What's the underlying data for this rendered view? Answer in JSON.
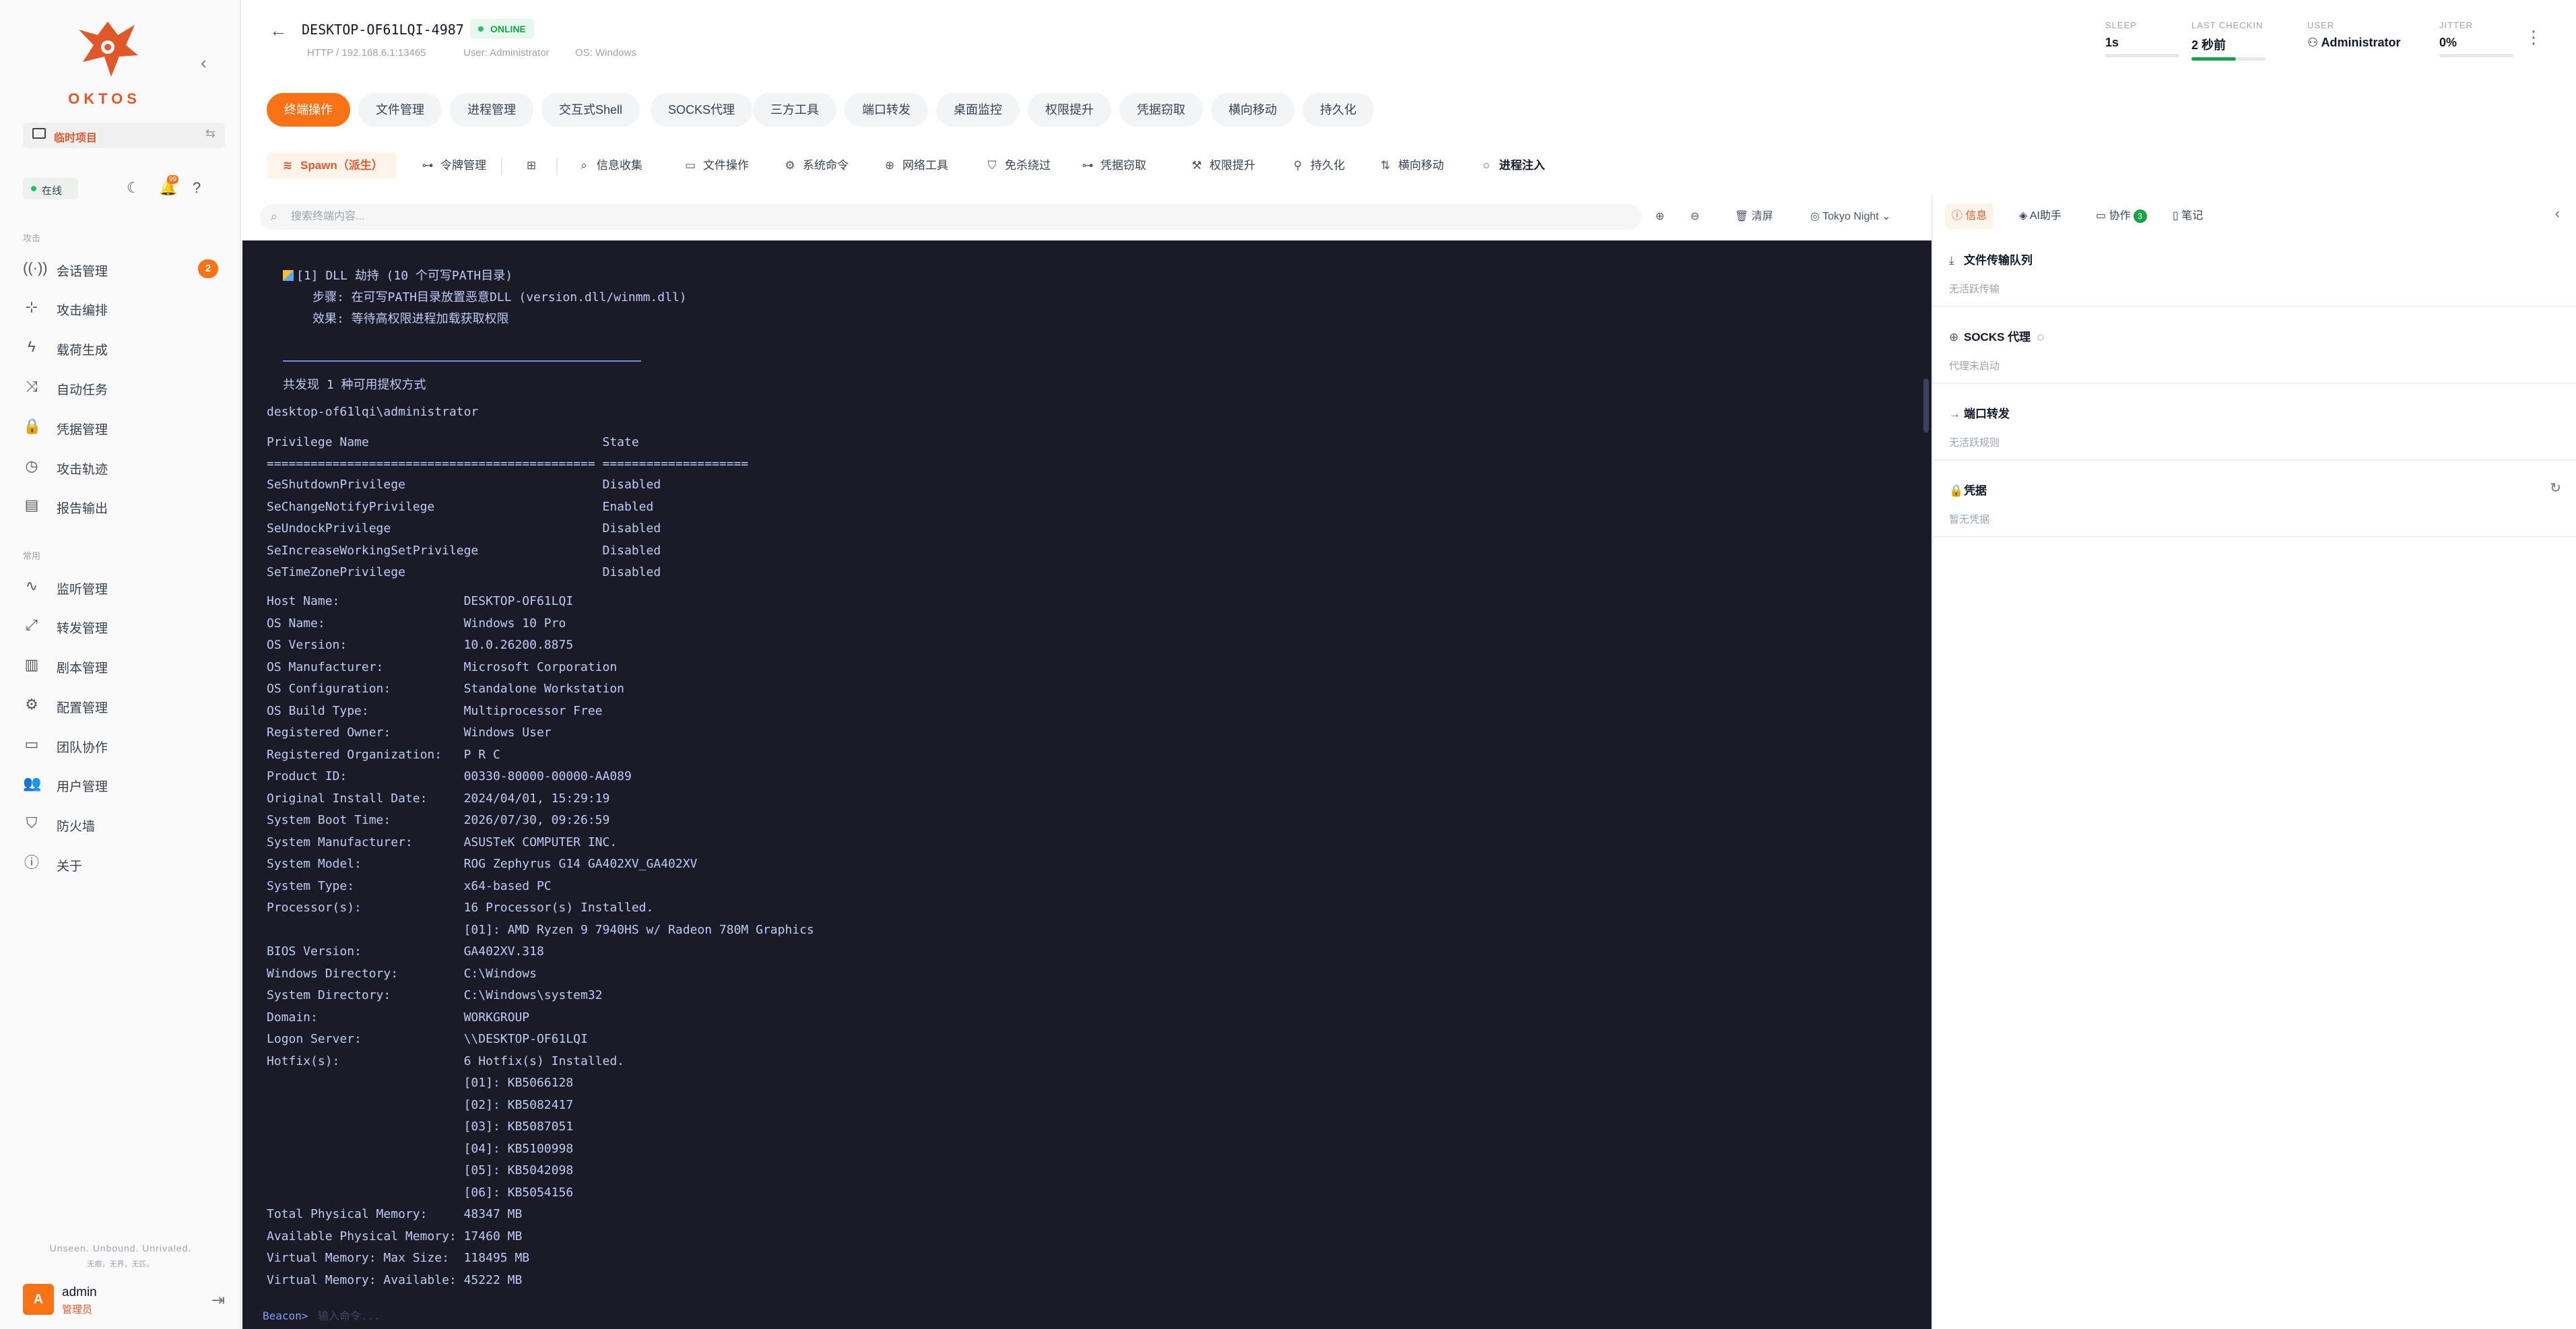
{
  "sidebar": {
    "logo_text": "OKTOS",
    "project_label": "临时项目",
    "online_label": "在线",
    "section_attack": "攻击",
    "section_common": "常用",
    "items_attack": [
      {
        "label": "会话管理",
        "badge": "2",
        "icon": "radio-icon"
      },
      {
        "label": "攻击编排",
        "icon": "graph-icon"
      },
      {
        "label": "载荷生成",
        "icon": "bolt-icon"
      },
      {
        "label": "自动任务",
        "icon": "shuffle-icon"
      },
      {
        "label": "凭据管理",
        "icon": "lock-icon"
      },
      {
        "label": "攻击轨迹",
        "icon": "clock-icon"
      },
      {
        "label": "报告输出",
        "icon": "document-icon"
      }
    ],
    "items_common": [
      {
        "label": "监听管理",
        "icon": "pulse-icon"
      },
      {
        "label": "转发管理",
        "icon": "arrows-icon"
      },
      {
        "label": "剧本管理",
        "icon": "book-icon"
      },
      {
        "label": "配置管理",
        "icon": "gear-icon"
      },
      {
        "label": "团队协作",
        "icon": "chat-icon"
      },
      {
        "label": "用户管理",
        "icon": "users-icon"
      },
      {
        "label": "防火墙",
        "icon": "shield-icon"
      },
      {
        "label": "关于",
        "icon": "info-icon"
      }
    ],
    "slogan_en": "Unseen. Unbound. Unrivaled.",
    "slogan_cn": "无痕，无界，无匹。",
    "user": {
      "avatar": "A",
      "name": "admin",
      "role": "管理员"
    }
  },
  "header": {
    "hostname": "DESKTOP-OF61LQI-4987",
    "status": "ONLINE",
    "listener": "HTTP / 192.168.6.1:13465",
    "user": "User: Administrator",
    "os": "OS: Windows",
    "stats": [
      {
        "label": "SLEEP",
        "value": "1s",
        "progress": 0
      },
      {
        "label": "LAST CHECKIN",
        "value": "2 秒前",
        "progress": 0.6
      },
      {
        "label": "USER",
        "value": "Administrator"
      },
      {
        "label": "JITTER",
        "value": "0%",
        "progress": 0
      }
    ]
  },
  "tabs": [
    "终端操作",
    "文件管理",
    "进程管理",
    "交互式Shell",
    "SOCKS代理",
    "三方工具",
    "端口转发",
    "桌面监控",
    "权限提升",
    "凭据窃取",
    "横向移动",
    "持久化"
  ],
  "toolbar": {
    "spawn": "Spawn（派生）",
    "items": [
      "令牌管理",
      "信息收集",
      "文件操作",
      "系统命令",
      "网络工具",
      "免杀绕过",
      "凭据窃取",
      "权限提升",
      "持久化",
      "横向移动",
      "进程注入"
    ]
  },
  "terminal_controls": {
    "search_placeholder": "搜索终端内容...",
    "clear": "清屏",
    "theme": "Tokyo Night"
  },
  "terminal": {
    "dll_line": "[1] DLL 劫持 (10 个可写PATH目录)",
    "dll_step": "步骤: 在可写PATH目录放置恶意DLL (version.dll/winmm.dll)",
    "dll_effect": "效果: 等待高权限进程加载获取权限",
    "found_line": "共发现 1 种可用提权方式",
    "whoami": "desktop-of61lqi\\administrator",
    "priv_header": "Privilege Name                                State",
    "priv_rule": "============================================= ====================",
    "privileges": [
      "SeShutdownPrivilege                           Disabled",
      "SeChangeNotifyPrivilege                       Enabled",
      "SeUndockPrivilege                             Disabled",
      "SeIncreaseWorkingSetPrivilege                 Disabled",
      "SeTimeZonePrivilege                           Disabled"
    ],
    "sysinfo": [
      "Host Name:                 DESKTOP-OF61LQI",
      "OS Name:                   Windows 10 Pro",
      "OS Version:                10.0.26200.8875",
      "OS Manufacturer:           Microsoft Corporation",
      "OS Configuration:          Standalone Workstation",
      "OS Build Type:             Multiprocessor Free",
      "Registered Owner:          Windows User",
      "Registered Organization:   P R C",
      "Product ID:                00330-80000-00000-AA089",
      "Original Install Date:     2024/04/01, 15:29:19",
      "System Boot Time:          2026/07/30, 09:26:59",
      "System Manufacturer:       ASUSTeK COMPUTER INC.",
      "System Model:              ROG Zephyrus G14 GA402XV_GA402XV",
      "System Type:               x64-based PC",
      "Processor(s):              16 Processor(s) Installed.",
      "                           [01]: AMD Ryzen 9 7940HS w/ Radeon 780M Graphics",
      "BIOS Version:              GA402XV.318",
      "Windows Directory:         C:\\Windows",
      "System Directory:          C:\\Windows\\system32",
      "Domain:                    WORKGROUP",
      "Logon Server:              \\\\DESKTOP-OF61LQI",
      "Hotfix(s):                 6 Hotfix(s) Installed.",
      "                           [01]: KB5066128",
      "                           [02]: KB5082417",
      "                           [03]: KB5087051",
      "                           [04]: KB5100998",
      "                           [05]: KB5042098",
      "                           [06]: KB5054156",
      "Total Physical Memory:     48347 MB",
      "Available Physical Memory: 17460 MB",
      "Virtual Memory: Max Size:  118495 MB",
      "Virtual Memory: Available: 45222 MB"
    ],
    "prompt": "Beacon>",
    "input_placeholder": "输入命令..."
  },
  "right_panel": {
    "tabs": [
      {
        "label": "信息",
        "icon": "info-icon"
      },
      {
        "label": "AI助手",
        "icon": "layers-icon"
      },
      {
        "label": "协作",
        "icon": "chat-icon",
        "badge": "3"
      },
      {
        "label": "笔记",
        "icon": "note-icon"
      }
    ],
    "sections": [
      {
        "title": "文件传输队列",
        "desc": "无活跃传输",
        "icon": "download-icon"
      },
      {
        "title": "SOCKS 代理",
        "desc": "代理未启动",
        "icon": "globe-icon"
      },
      {
        "title": "端口转发",
        "desc": "无活跃规则",
        "icon": "arrow-right-icon"
      },
      {
        "title": "凭据",
        "desc": "暂无凭据",
        "icon": "lock-icon"
      }
    ]
  },
  "colors": {
    "accent": "#f97316",
    "online": "#22c55e",
    "terminal_bg": "#1a1b26",
    "terminal_fg": "#c0caf5"
  }
}
